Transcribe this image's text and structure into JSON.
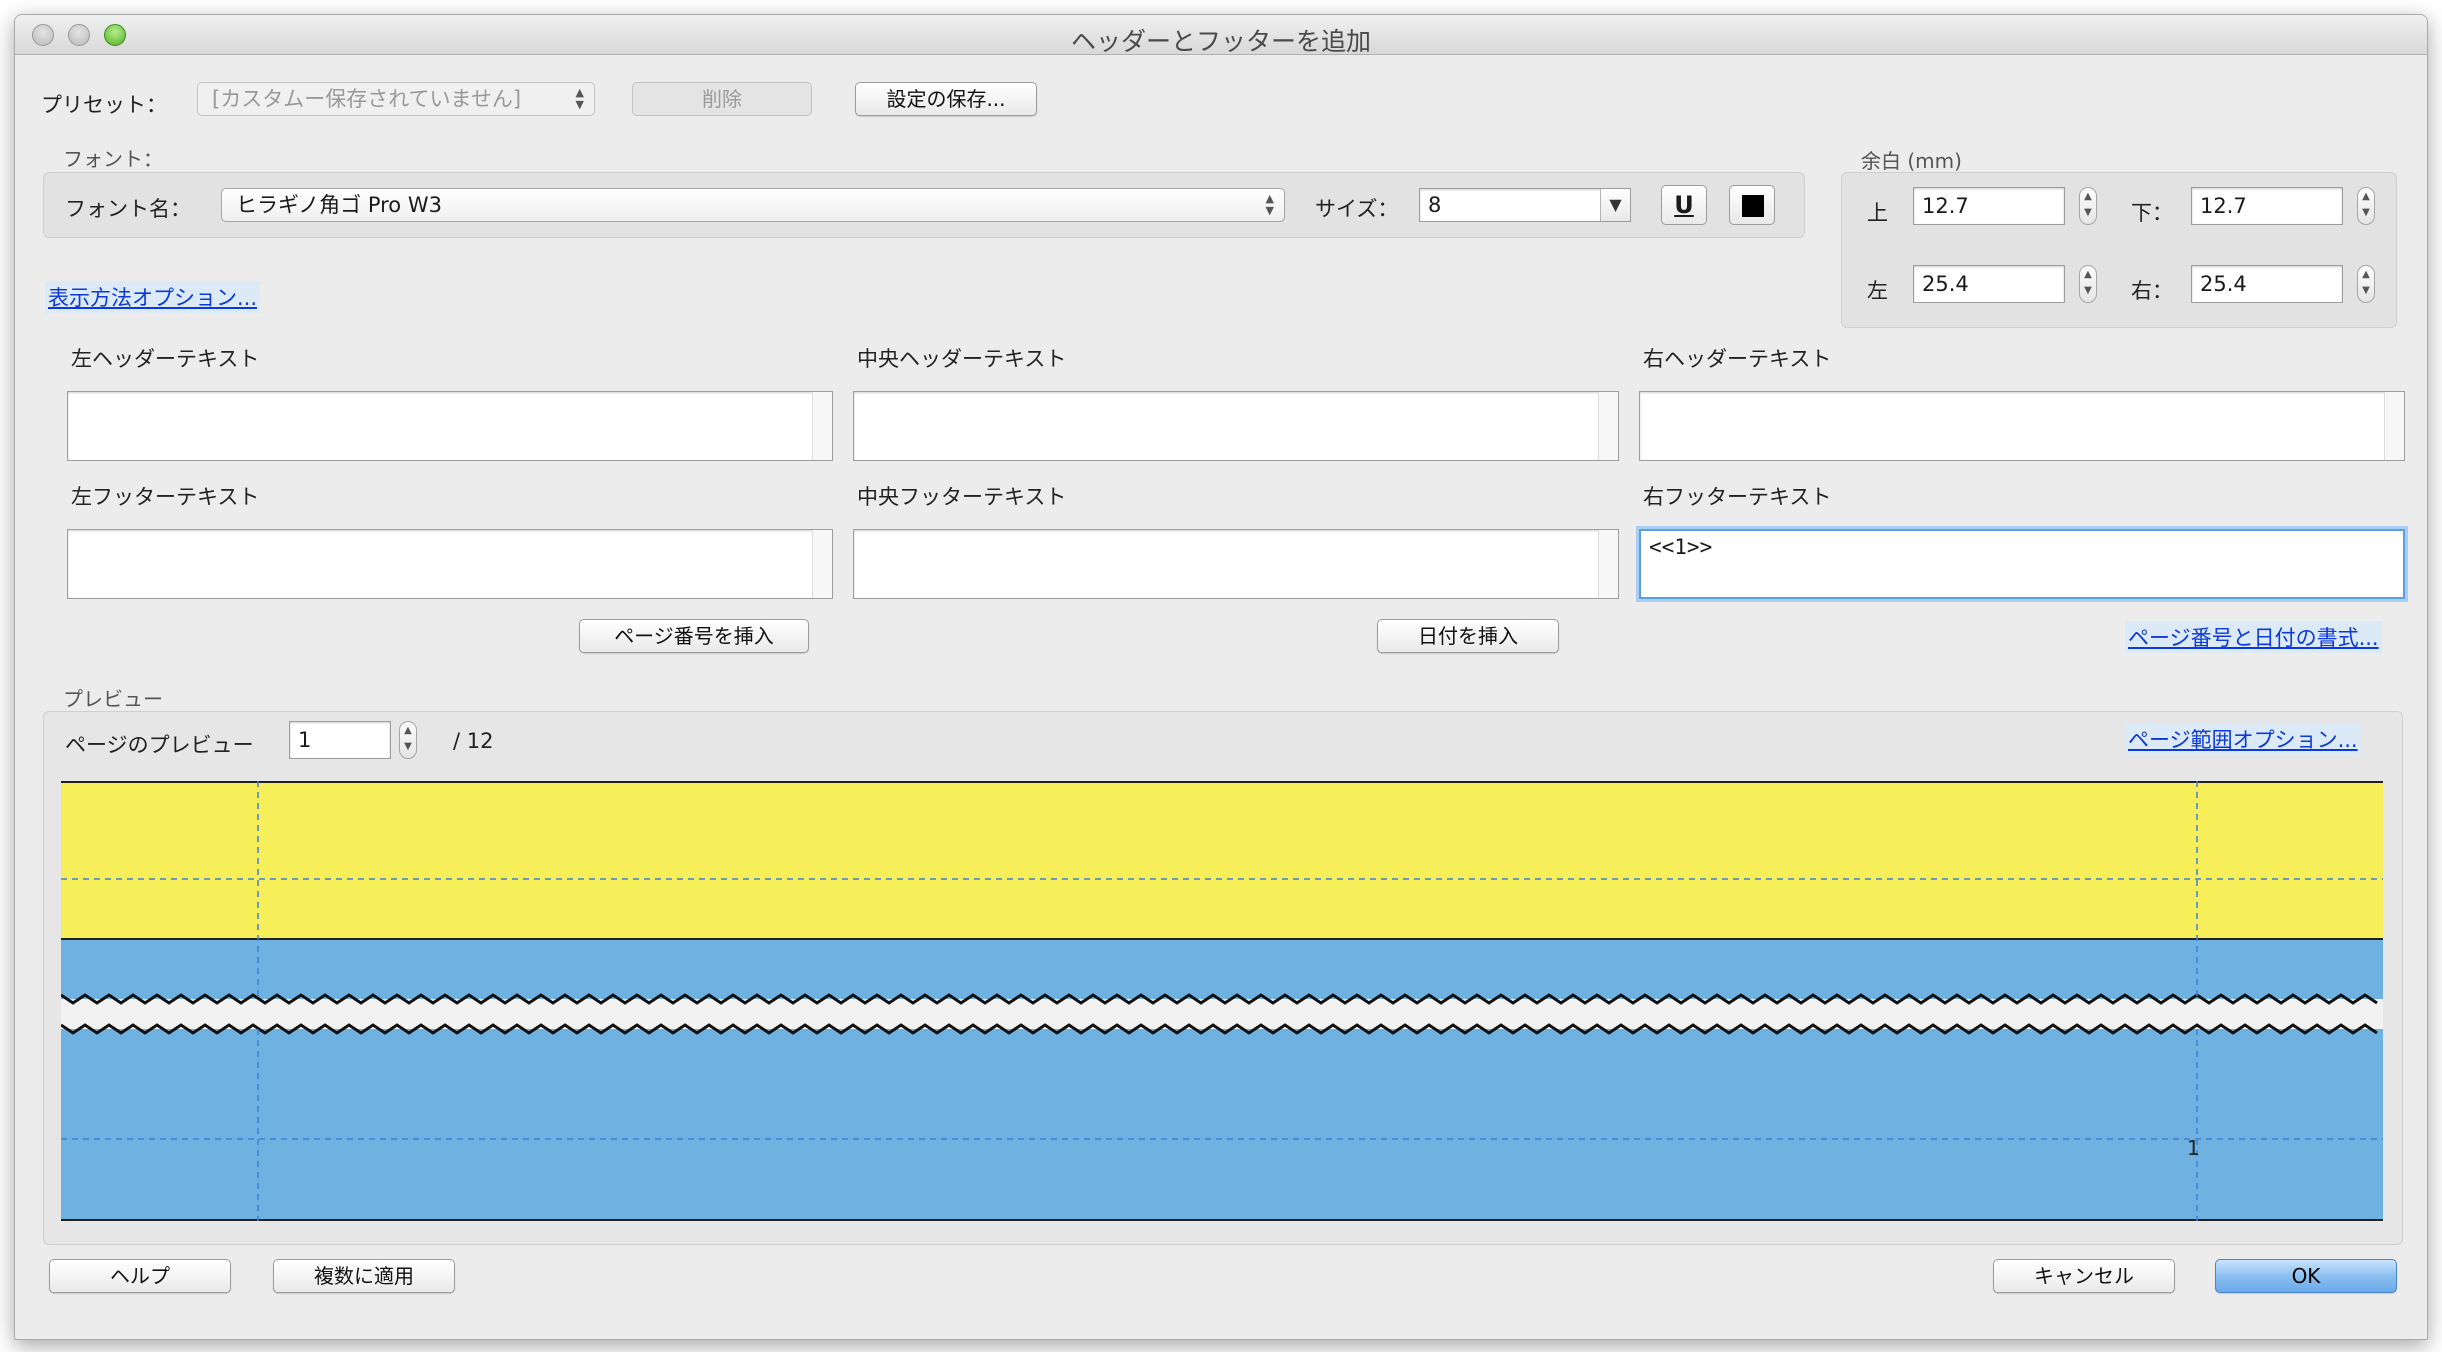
{
  "window": {
    "title": "ヘッダーとフッターを追加"
  },
  "preset": {
    "label": "プリセット：",
    "value": "[カスタムー保存されていません]",
    "delete_label": "削除",
    "save_label": "設定の保存..."
  },
  "font": {
    "group_label": "フォント：",
    "name_label": "フォント名：",
    "name_value": "ヒラギノ角ゴ Pro W3",
    "size_label": "サイズ：",
    "size_value": "8",
    "underline_glyph": "U",
    "color_swatch": "#000000"
  },
  "display_options_link": "表示方法オプション...",
  "margins": {
    "group_label": "余白 (mm)",
    "top_label": "上",
    "top_value": "12.7",
    "bottom_label": "下：",
    "bottom_value": "12.7",
    "left_label": "左",
    "left_value": "25.4",
    "right_label": "右：",
    "right_value": "25.4"
  },
  "headers": {
    "left_label": "左ヘッダーテキスト",
    "left_value": "",
    "center_label": "中央ヘッダーテキスト",
    "center_value": "",
    "right_label": "右ヘッダーテキスト",
    "right_value": ""
  },
  "footers": {
    "left_label": "左フッターテキスト",
    "left_value": "",
    "center_label": "中央フッターテキスト",
    "center_value": "",
    "right_label": "右フッターテキスト",
    "right_value": "<<1>>"
  },
  "insert": {
    "page_number_label": "ページ番号を挿入",
    "date_label": "日付を挿入",
    "format_link": "ページ番号と日付の書式..."
  },
  "preview": {
    "group_label": "プレビュー",
    "page_label": "ページのプレビュー",
    "page_value": "1",
    "total": "/ 12",
    "range_link": "ページ範囲オプション...",
    "page_number_marker": "1",
    "header_color": "#f7ef5a",
    "body_color": "#6fb2e1"
  },
  "footer_buttons": {
    "help_label": "ヘルプ",
    "apply_multiple_label": "複数に適用",
    "cancel_label": "キャンセル",
    "ok_label": "OK"
  }
}
